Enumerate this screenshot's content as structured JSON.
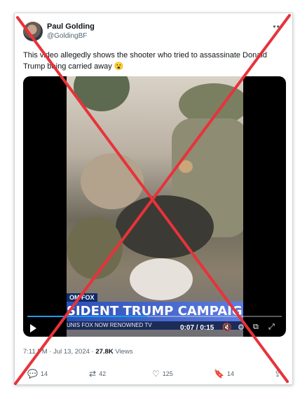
{
  "tweet": {
    "author_name": "Paul Golding",
    "author_handle": "@GoldingBF",
    "text": "This video allegedly shows the shooter who tried to assassinate Donald Trump being carried away 😮",
    "timestamp": "7:11 PM · Jul 13, 2024",
    "views_count": "27.8K",
    "views_label": "Views"
  },
  "video": {
    "channel_tag": "OM FOX",
    "headline": "SIDENT TRUMP CAMPAIGNS IN",
    "subticker": "UNIS   FOX NOW   RENOWNED   TV",
    "time_display": "0:07 / 0:15",
    "progress": 0.47
  },
  "actions": {
    "replies": "14",
    "reposts": "42",
    "likes": "125",
    "bookmarks": "14"
  },
  "icons": {
    "more": "more-icon",
    "reply": "reply-icon",
    "repost": "repost-icon",
    "like": "like-icon",
    "bookmark": "bookmark-icon",
    "share": "share-icon",
    "play": "play-icon",
    "volume": "volume-icon",
    "settings": "settings-icon",
    "pip": "pip-icon",
    "fullscreen": "fullscreen-icon"
  },
  "colors": {
    "overlay_cross": "#e8323a",
    "accent": "#1d9bf0",
    "ticker": "#2b4fb6"
  }
}
